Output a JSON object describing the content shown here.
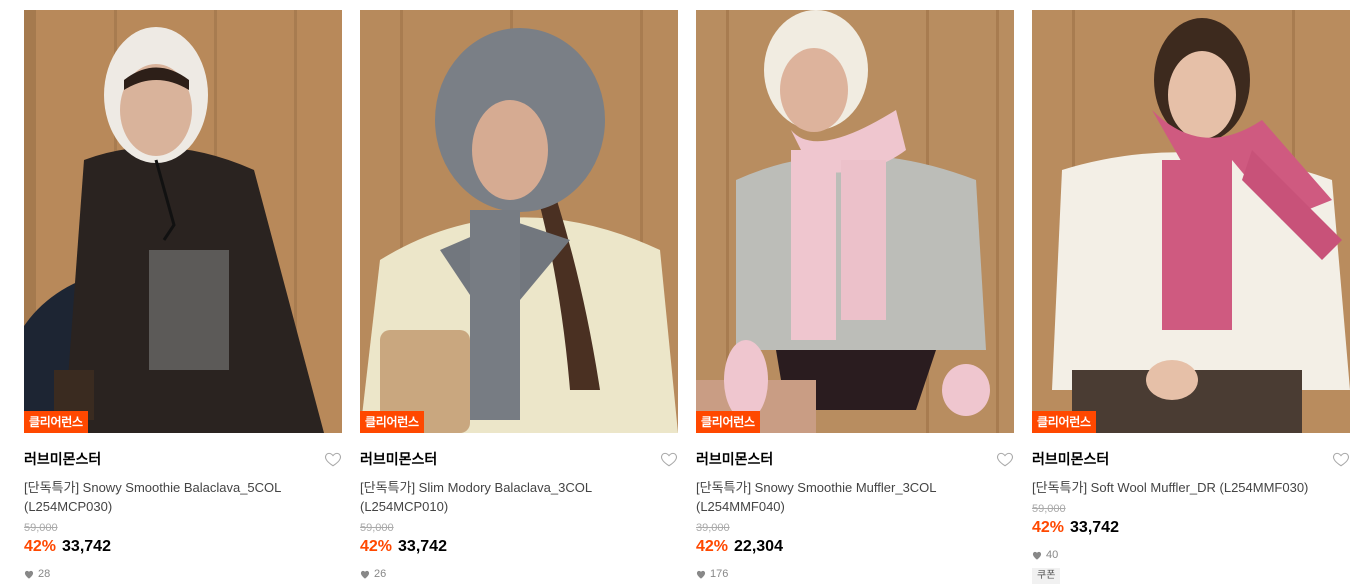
{
  "products": [
    {
      "badge": "클리어런스",
      "brand": "러브미몬스터",
      "name": "[단독특가] Snowy Smoothie Balaclava_5COL (L254MCP030)",
      "original_price": "59,000",
      "discount": "42%",
      "price": "33,742",
      "likes": "28",
      "image": "model wearing white fluffy knit balaclava and black tweed jacket",
      "colors": {
        "bg": "#b8895a",
        "garment": "#2a2320",
        "accent": "#eeeae4"
      }
    },
    {
      "badge": "클리어런스",
      "brand": "러브미몬스터",
      "name": "[단독특가] Slim Modory Balaclava_3COL (L254MCP010)",
      "original_price": "59,000",
      "discount": "42%",
      "price": "33,742",
      "likes": "26",
      "image": "model wearing grey knit balaclava with bow and cream sweater",
      "colors": {
        "bg": "#b78a5c",
        "garment": "#ece6c9",
        "accent": "#7a7f86"
      }
    },
    {
      "badge": "클리어런스",
      "brand": "러브미몬스터",
      "name": "[단독특가] Snowy Smoothie Muffler_3COL (L254MMF040)",
      "original_price": "39,000",
      "discount": "42%",
      "price": "22,304",
      "likes": "176",
      "image": "model wearing pink fluffy muffler, ivory bonnet and grey mohair sweater",
      "colors": {
        "bg": "#b88d60",
        "garment": "#bcbdb8",
        "accent": "#efc6cf"
      }
    },
    {
      "badge": "클리어런스",
      "brand": "러브미몬스터",
      "name": "[단독특가] Soft Wool Muffler_DR (L254MMF030)",
      "original_price": "59,000",
      "discount": "42%",
      "price": "33,742",
      "likes": "40",
      "coupon": "쿠폰",
      "image": "model wearing pink wool fringed muffler and white sweater",
      "colors": {
        "bg": "#b98c5e",
        "garment": "#f3efe6",
        "accent": "#cf5a80"
      }
    }
  ],
  "colors": {
    "discount": "#ff4800",
    "badge_bg": "#ff4800"
  }
}
